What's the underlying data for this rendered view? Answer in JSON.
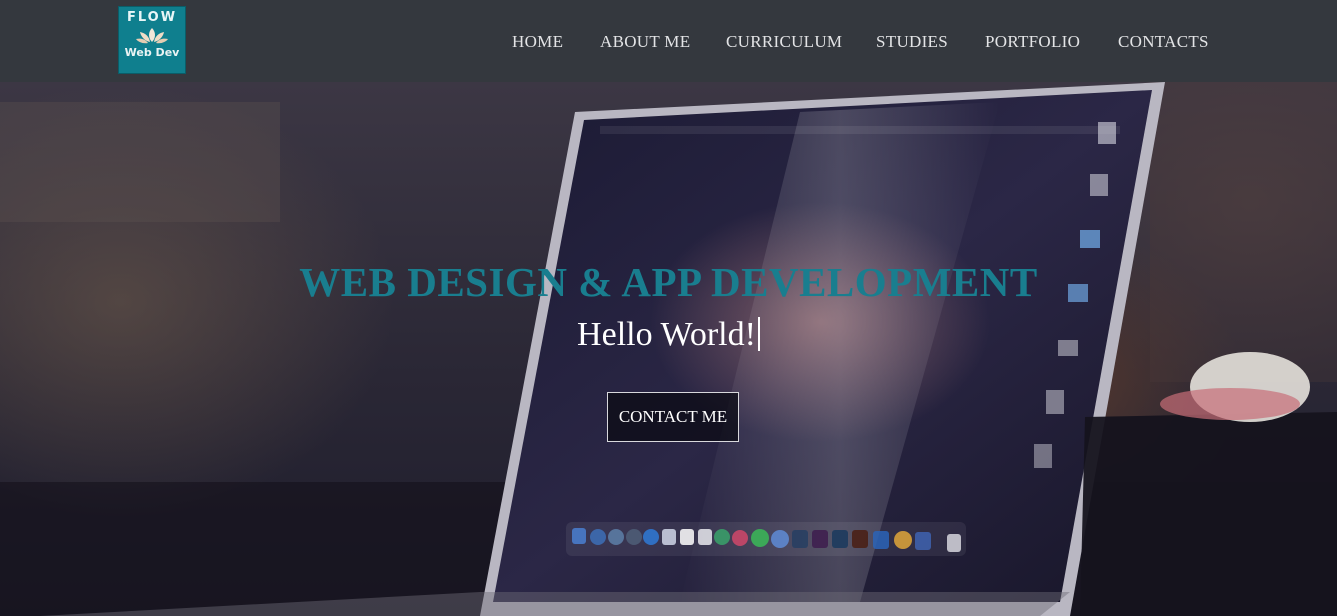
{
  "header": {
    "logo": {
      "line1": "FLOW",
      "line2": "Web Dev"
    },
    "nav": [
      {
        "label": "HOME"
      },
      {
        "label": "ABOUT ME"
      },
      {
        "label": "CURRICULUM"
      },
      {
        "label": "STUDIES"
      },
      {
        "label": "PORTFOLIO"
      },
      {
        "label": "CONTACTS"
      }
    ]
  },
  "hero": {
    "title": "WEB DESIGN & APP DEVELOPMENT",
    "subtitle": "Hello World!",
    "cta_label": "CONTACT ME"
  },
  "colors": {
    "navbar": "#34383e",
    "accent_teal": "#197e8f",
    "logo_bg": "#0f7f8e",
    "nav_text": "#e3e4e6"
  }
}
